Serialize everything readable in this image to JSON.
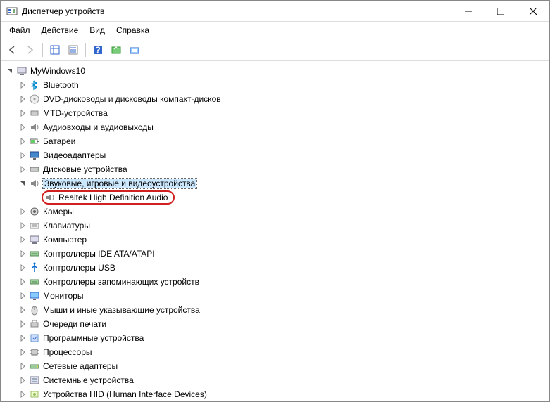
{
  "window": {
    "title": "Диспетчер устройств"
  },
  "menu": {
    "file": "Файл",
    "action": "Действие",
    "view": "Вид",
    "help": "Справка"
  },
  "tree": {
    "root": "MyWindows10",
    "items": [
      {
        "label": "Bluetooth",
        "icon": "bluetooth"
      },
      {
        "label": "DVD-дисководы и дисководы компакт-дисков",
        "icon": "disc"
      },
      {
        "label": "MTD-устройства",
        "icon": "generic"
      },
      {
        "label": "Аудиовходы и аудиовыходы",
        "icon": "speaker"
      },
      {
        "label": "Батареи",
        "icon": "battery"
      },
      {
        "label": "Видеоадаптеры",
        "icon": "display"
      },
      {
        "label": "Дисковые устройства",
        "icon": "hdd"
      },
      {
        "label": "Звуковые, игровые и видеоустройства",
        "icon": "speaker",
        "expanded": true,
        "selected": true,
        "children": [
          {
            "label": "Realtek High Definition Audio",
            "icon": "speaker",
            "highlighted": true
          }
        ]
      },
      {
        "label": "Камеры",
        "icon": "camera"
      },
      {
        "label": "Клавиатуры",
        "icon": "keyboard"
      },
      {
        "label": "Компьютер",
        "icon": "computer"
      },
      {
        "label": "Контроллеры IDE ATA/ATAPI",
        "icon": "controller"
      },
      {
        "label": "Контроллеры USB",
        "icon": "usb"
      },
      {
        "label": "Контроллеры запоминающих устройств",
        "icon": "controller"
      },
      {
        "label": "Мониторы",
        "icon": "monitor"
      },
      {
        "label": "Мыши и иные указывающие устройства",
        "icon": "mouse"
      },
      {
        "label": "Очереди печати",
        "icon": "printer"
      },
      {
        "label": "Программные устройства",
        "icon": "software"
      },
      {
        "label": "Процессоры",
        "icon": "cpu"
      },
      {
        "label": "Сетевые адаптеры",
        "icon": "network"
      },
      {
        "label": "Системные устройства",
        "icon": "system"
      },
      {
        "label": "Устройства HID (Human Interface Devices)",
        "icon": "hid"
      }
    ]
  }
}
